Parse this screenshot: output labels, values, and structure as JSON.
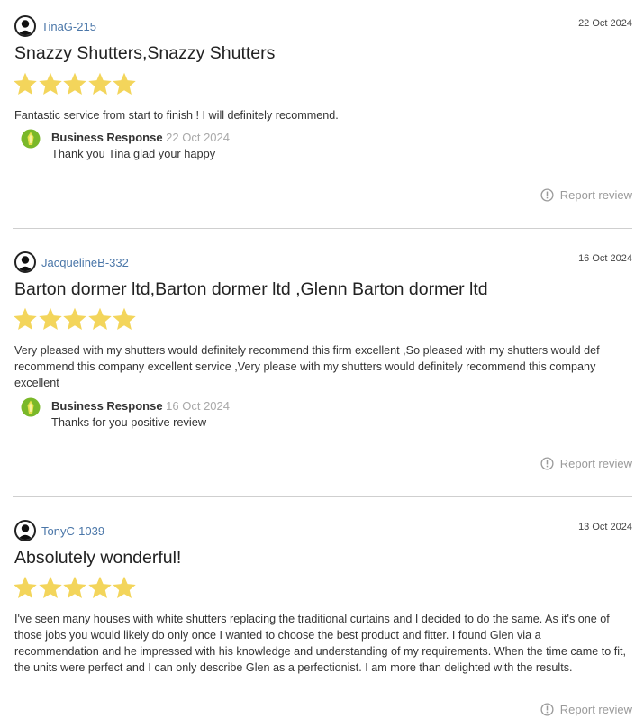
{
  "reviews": [
    {
      "username": "TinaG-215",
      "date": "22 Oct 2024",
      "title": "Snazzy Shutters,Snazzy Shutters",
      "rating": 5,
      "body": "Fantastic service from start to finish ! I will definitely recommend.",
      "response": {
        "label": "Business Response",
        "date": "22 Oct 2024",
        "text": "Thank you Tina glad your happy"
      },
      "report_label": "Report review"
    },
    {
      "username": "JacquelineB-332",
      "date": "16 Oct 2024",
      "title": "Barton dormer ltd,Barton dormer ltd ,Glenn Barton dormer ltd",
      "rating": 5,
      "body": "Very pleased with my shutters would definitely recommend this firm excellent ,So pleased with my shutters would def recommend this company excellent service ,Very please with my shutters would definitely recommend this company excellent",
      "response": {
        "label": "Business Response",
        "date": "16 Oct 2024",
        "text": "Thanks for you positive review"
      },
      "report_label": "Report review"
    },
    {
      "username": "TonyC-1039",
      "date": "13 Oct 2024",
      "title": "Absolutely wonderful!",
      "rating": 5,
      "body": "I've seen many houses with white shutters replacing the traditional curtains and I decided to do the same. As it's one of those jobs you would likely do only once I wanted to choose the best product and fitter. I found Glen via a recommendation and he impressed with his knowledge and understanding of my requirements. When the time came to fit, the units were perfect and I can only describe Glen as a perfectionist. I am more than delighted with the results.",
      "report_label": "Report review"
    }
  ],
  "colors": {
    "star": "#f3d55b",
    "username": "#4a76a8",
    "response_logo": "#7ab829",
    "divider": "#cfcfcf"
  },
  "icons": {
    "avatar": "user-silhouette-icon",
    "star": "star-icon",
    "response": "business-logo-icon",
    "report": "exclamation-circle-icon"
  }
}
